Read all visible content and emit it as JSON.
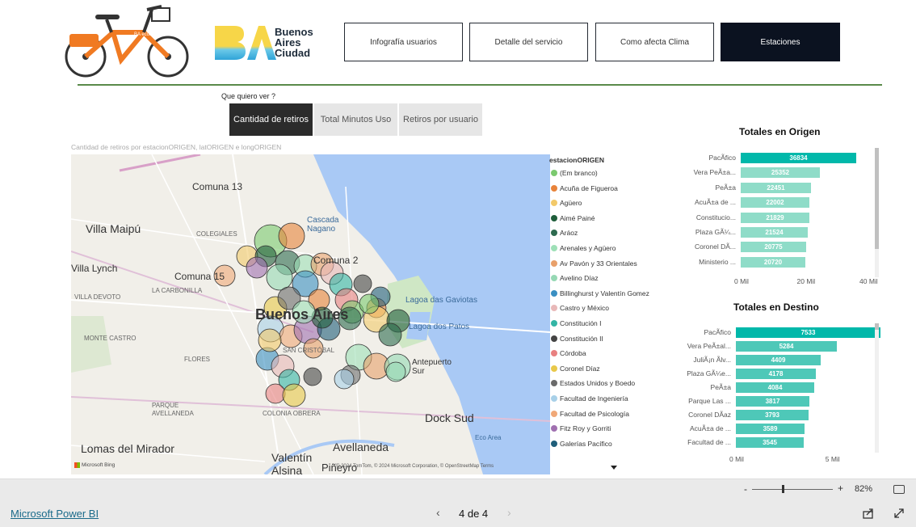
{
  "header": {
    "logo_text": [
      "Buenos",
      "Aires",
      "Ciudad"
    ],
    "nav": [
      {
        "label": "Infografía usuarios",
        "active": false
      },
      {
        "label": "Detalle del servicio",
        "active": false
      },
      {
        "label": "Como afecta Clima",
        "active": false
      },
      {
        "label": "Estaciones",
        "active": true
      }
    ]
  },
  "selector": {
    "title": "Que quiero ver ?",
    "options": [
      {
        "label": "Cantidad de retiros",
        "active": true
      },
      {
        "label": "Total Minutos Uso",
        "active": false
      },
      {
        "label": "Retiros por usuario",
        "active": false
      }
    ]
  },
  "map": {
    "title": "Cantidad de retiros por estacionORIGEN, latORIGEN e longORIGEN",
    "place_labels": [
      "Comuna 13",
      "Villa Maipú",
      "COLEGIALES",
      "Villa Lynch",
      "Comuna 15",
      "LA CARBONILLA",
      "VILLA DEVOTO",
      "Cascada Nagano",
      "Comuna 2",
      "Buenos Aires",
      "Lagoa das Gaviotas",
      "Lagoa dos Patos",
      "MONTE CASTRO",
      "FLORES",
      "SAN CRISTÓBAL",
      "Antepuerto Sur",
      "PARQUE AVELLANEDA",
      "COLONIA OBRERA",
      "Dock Sud",
      "Lomas del Mirador",
      "Avellaneda",
      "Valentín Alsina",
      "Piñeyro",
      "Eco Area"
    ],
    "attribution": "© 2024 TomTom, © 2024 Microsoft Corporation, © OpenStreetMap  Terms",
    "bing": "Microsoft Bing"
  },
  "legend": {
    "title": "estacionORIGEN",
    "items": [
      {
        "label": "(Em branco)",
        "color": "#7bc96f"
      },
      {
        "label": "Acuña de Figueroa",
        "color": "#e8833a"
      },
      {
        "label": "Agüero",
        "color": "#f2c96a"
      },
      {
        "label": "Aimé Painé",
        "color": "#1f5e3b"
      },
      {
        "label": "Aráoz",
        "color": "#2d6a4f"
      },
      {
        "label": "Arenales y Agüero",
        "color": "#9ee0b7"
      },
      {
        "label": "Av Pavón y 33 Orientales",
        "color": "#e8a06a"
      },
      {
        "label": "Avelino Díaz",
        "color": "#96d8b4"
      },
      {
        "label": "Billinghurst y Valentín Gomez",
        "color": "#3a8fc2"
      },
      {
        "label": "Castro y México",
        "color": "#e8b8b8"
      },
      {
        "label": "Constitución I",
        "color": "#33b5a5"
      },
      {
        "label": "Constitución II",
        "color": "#444444"
      },
      {
        "label": "Córdoba",
        "color": "#e88080"
      },
      {
        "label": "Coronel Díaz",
        "color": "#e8c84a"
      },
      {
        "label": "Estados Unidos y Boedo",
        "color": "#6a6a6a"
      },
      {
        "label": "Facultad de Ingeniería",
        "color": "#a8d0e8"
      },
      {
        "label": "Facultad de Psicología",
        "color": "#f0a878"
      },
      {
        "label": "Fitz Roy y Gorriti",
        "color": "#a070b0"
      },
      {
        "label": "Galerías Pacífico",
        "color": "#1f5e7a"
      }
    ]
  },
  "chart_data": [
    {
      "type": "bar",
      "title": "Totales en Origen",
      "categories": [
        "PacÃfico",
        "Vera PeÃ±a...",
        "PeÃ±a",
        "AcuÃ±a de ...",
        "Constitucio...",
        "Plaza GÃ¼...",
        "Coronel DÃ...",
        "Ministerio ..."
      ],
      "values": [
        36834,
        25352,
        22451,
        22002,
        21829,
        21524,
        20775,
        20720
      ],
      "value_labels": [
        "36834",
        "25352",
        "22451",
        "22002",
        "21829",
        "21524",
        "20775",
        "20720"
      ],
      "xlim": [
        0,
        40000
      ],
      "ticks": [
        "0 Mil",
        "20 Mil",
        "40 Mil"
      ],
      "highlight_color": "#01b8aa",
      "bar_color": "#8fdcc8"
    },
    {
      "type": "bar",
      "title": "Totales en Destino",
      "categories": [
        "PacÃfico",
        "Vera PeÃ±al...",
        "JuliÃ¡n Ãlv...",
        "Plaza GÃ¼e...",
        "PeÃ±a",
        "Parque Las ...",
        "Coronel DÃaz",
        "AcuÃ±a de ...",
        "Facultad de ..."
      ],
      "values": [
        7533,
        5284,
        4409,
        4178,
        4084,
        3817,
        3793,
        3589,
        3545
      ],
      "value_labels": [
        "7533",
        "5284",
        "4409",
        "4178",
        "4084",
        "3817",
        "3793",
        "3589",
        "3545"
      ],
      "xlim": [
        0,
        8000
      ],
      "ticks": [
        "0 Mil",
        "5 Mil"
      ],
      "highlight_color": "#01b8aa",
      "bar_color": "#4ec8b8"
    }
  ],
  "footer": {
    "brand": "Microsoft Power BI",
    "page": "4 de 4",
    "zoom": "82%"
  }
}
